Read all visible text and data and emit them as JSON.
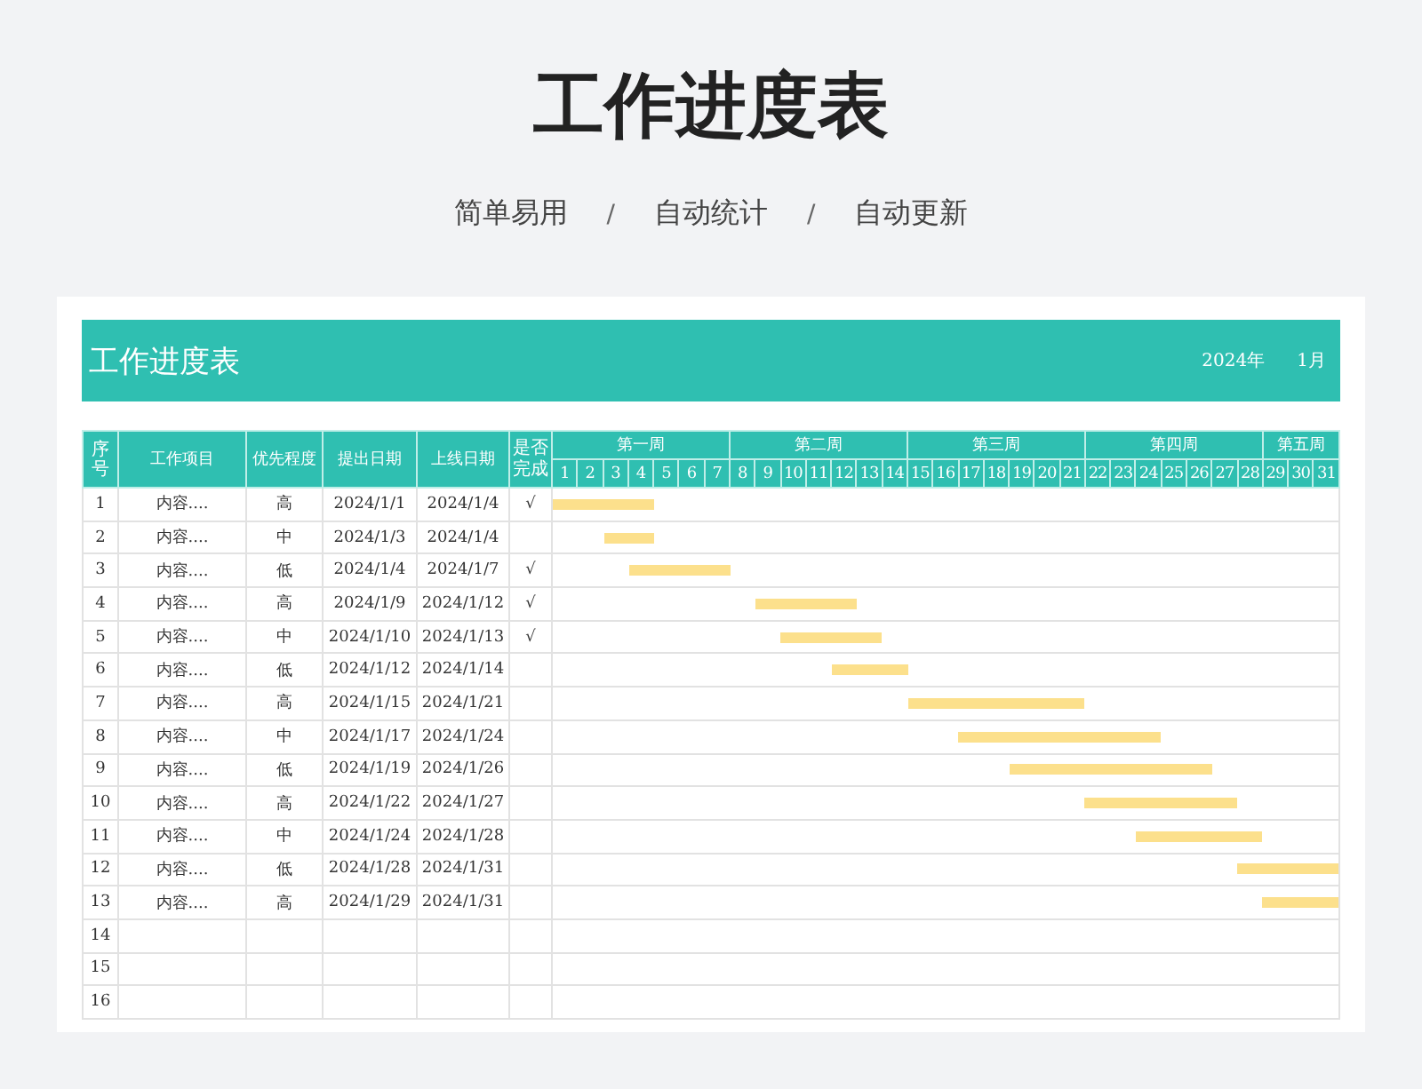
{
  "title": "工作进度表",
  "subtitle": {
    "separator": "/",
    "items": [
      "简单易用",
      "自动统计",
      "自动更新"
    ]
  },
  "sheet": {
    "title": "工作进度表",
    "year": "2024年",
    "month": "1月"
  },
  "table": {
    "columns": [
      "序号",
      "工作项目",
      "优先程度",
      "提出日期",
      "上线日期",
      "是否完成"
    ],
    "check_mark": "√",
    "weeks": [
      {
        "label": "第一周",
        "days": [
          "1",
          "2",
          "3",
          "4",
          "5",
          "6",
          "7"
        ]
      },
      {
        "label": "第二周",
        "days": [
          "8",
          "9",
          "10",
          "11",
          "12",
          "13",
          "14"
        ]
      },
      {
        "label": "第三周",
        "days": [
          "15",
          "16",
          "17",
          "18",
          "19",
          "20",
          "21"
        ]
      },
      {
        "label": "第四周",
        "days": [
          "22",
          "23",
          "24",
          "25",
          "26",
          "27",
          "28"
        ]
      },
      {
        "label": "第五周",
        "days": [
          "29",
          "30",
          "31"
        ]
      }
    ],
    "rows": [
      {
        "no": "1",
        "item": "内容....",
        "priority": "高",
        "submitted": "2024/1/1",
        "launch": "2024/1/4",
        "done": true
      },
      {
        "no": "2",
        "item": "内容....",
        "priority": "中",
        "submitted": "2024/1/3",
        "launch": "2024/1/4",
        "done": false
      },
      {
        "no": "3",
        "item": "内容....",
        "priority": "低",
        "submitted": "2024/1/4",
        "launch": "2024/1/7",
        "done": true
      },
      {
        "no": "4",
        "item": "内容....",
        "priority": "高",
        "submitted": "2024/1/9",
        "launch": "2024/1/12",
        "done": true
      },
      {
        "no": "5",
        "item": "内容....",
        "priority": "中",
        "submitted": "2024/1/10",
        "launch": "2024/1/13",
        "done": true
      },
      {
        "no": "6",
        "item": "内容....",
        "priority": "低",
        "submitted": "2024/1/12",
        "launch": "2024/1/14",
        "done": false
      },
      {
        "no": "7",
        "item": "内容....",
        "priority": "高",
        "submitted": "2024/1/15",
        "launch": "2024/1/21",
        "done": false
      },
      {
        "no": "8",
        "item": "内容....",
        "priority": "中",
        "submitted": "2024/1/17",
        "launch": "2024/1/24",
        "done": false
      },
      {
        "no": "9",
        "item": "内容....",
        "priority": "低",
        "submitted": "2024/1/19",
        "launch": "2024/1/26",
        "done": false
      },
      {
        "no": "10",
        "item": "内容....",
        "priority": "高",
        "submitted": "2024/1/22",
        "launch": "2024/1/27",
        "done": false
      },
      {
        "no": "11",
        "item": "内容....",
        "priority": "中",
        "submitted": "2024/1/24",
        "launch": "2024/1/28",
        "done": false
      },
      {
        "no": "12",
        "item": "内容....",
        "priority": "低",
        "submitted": "2024/1/28",
        "launch": "2024/1/31",
        "done": false
      },
      {
        "no": "13",
        "item": "内容....",
        "priority": "高",
        "submitted": "2024/1/29",
        "launch": "2024/1/31",
        "done": false
      },
      {
        "no": "14"
      },
      {
        "no": "15"
      },
      {
        "no": "16"
      }
    ]
  }
}
